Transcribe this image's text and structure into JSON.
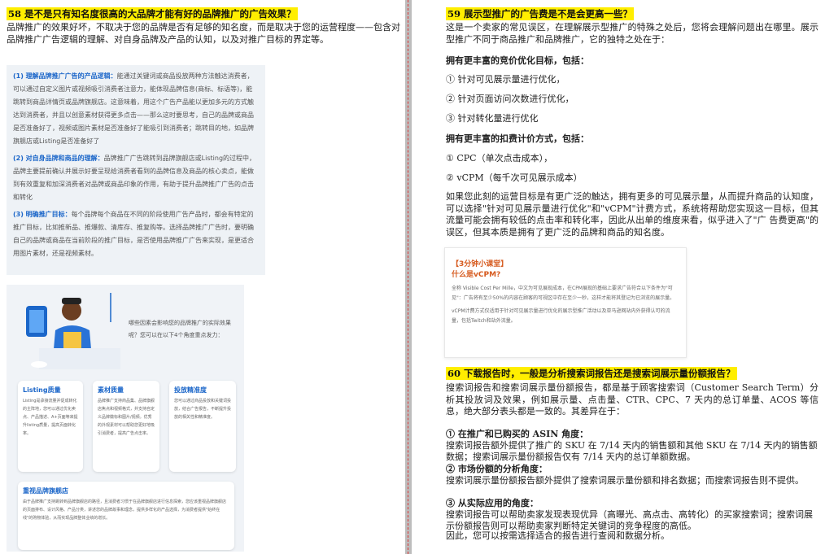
{
  "left": {
    "q58_title": "58 是不是只有知名度很高的大品牌才能有好的品牌推广的广告效果？",
    "q58_intro": "品牌推广的效果好坏，不取决于您的品牌是否有足够的知名度，而是取决于您的运营程度——包含对品牌推广广告逻辑的理解、对自身品牌及产品的认知，以及对推广目标的界定等。",
    "box": [
      {
        "head": "(1) 理解品牌推广广告的产品逻辑：",
        "body": "能通过关键词或商品投放两种方法触达消费者，可以通过自定义图片或视频吸引消费者注意力，能体现品牌信息(商标、标语等)，能跳转到商品详情页或品牌旗舰店。这意味着，用这个广告产品能以更加多元的方式触达到消费者，并且以创意素材获得更多点击——那么这时要思考，自己的品牌或商品是否准备好了，视频或图片素材是否准备好了能吸引到消费者；跳转目的地，如品牌旗舰店或Listing是否准备好了"
      },
      {
        "head": "(2) 对自身品牌和商品的理解：",
        "body": "品牌推广广告跳转到品牌旗舰店或Listing的过程中，品牌主要提前确认并展示好要呈现给消费者看到的品牌信息及商品的核心卖点，能做到有效重复和加深消费者对品牌或商品印象的作用，有助于提升品牌推广广告的点击和转化"
      },
      {
        "head": "(3) 明确推广目标：",
        "body": "每个品牌每个商品在不同的阶段使用广告产品时，都会有特定的推广目标，比如推新品、推爆款、清库存、推复购等。选择品牌推广广告时，要明确自己的品牌或商品在当前阶段的推广目标，是否使用品牌推广广告来实现，是更适合用图片素材，还是视频素材。"
      }
    ],
    "infographic": {
      "question": "哪些因素会影响您的品牌推广的实际效果呢？您可以在以下4个角度重点发力：",
      "cards": [
        {
          "title": "Listing质量",
          "body": "Listing是承接流量并促成转化的主阵地，您可以通过优化卖点、产品描述、A+页面等来提升listing质量，提高页面转化率。"
        },
        {
          "title": "素材质量",
          "body": "品牌推广支持商品集、品牌旗舰店焦点和视频格式，并支持自定义品牌徽标和图片/视频。优秀的外观素材可以帮助您更好地吸引消费者，提高广告点击率。"
        },
        {
          "title": "投放精准度",
          "body": "您可以通过商品投放和关键词投放，结合广告报告，不断提升投放的相关性和精准度。"
        },
        {
          "title": "重视品牌旗舰店",
          "body": "由于品牌推广支持跳转到品牌旗舰店的路径，且消费者习惯于在品牌旗舰店进行信息探索，您应该重视品牌旗舰店的页面排布、设计风格、产品分类，讲述您的品牌故事和理念，提供多样化的产品选择，为消费者提供\"始终在线\"的购物体验，从而实现品牌整体业绩的增长。"
        }
      ]
    }
  },
  "right": {
    "q59_title": "59 展示型推广的广告费是不是会更高一些？",
    "q59_intro": "这是一个卖家的常见误区，在理解展示型推广的特殊之处后，您将会理解问题出在哪里。展示型推广不同于商品推广和品牌推广，它的独特之处在于：",
    "h_targets": "拥有更丰富的竞价优化目标，包括：",
    "targets": [
      "① 针对可见展示量进行优化，",
      "② 针对页面访问次数进行优化，",
      "③ 针对转化量进行优化"
    ],
    "h_billing": "拥有更丰富的扣费计价方式，包括：",
    "billing": [
      "① CPC（单次点击成本），",
      "② vCPM（每千次可见展示成本）"
    ],
    "conclusion": "如果您此刻的运营目标是有更广泛的触达，拥有更多的可见展示量，从而提升商品的认知度，可以选择\"针对可见展示量进行优化\"和\"vCPM\"计费方式，系统将帮助您实现这一目标，但其流量可能会拥有较低的点击率和转化率，因此从出单的维度来看，似乎进入了\"广 告费更高\"的误区，但其本质是拥有了更广泛的品牌和商品的知名度。",
    "note": {
      "tag": "【3分钟小课堂】",
      "title": "什么是vCPM?",
      "p1": "全称 Visible Cost Per Mille，中文为可见展现成本，在CPM展现的基础上要求广告符合以下条件为\"可见\"：广告将有至少50%的内容在顾客的可视区中存在至少一秒，这样才能将其登记为已浏览的展示量。",
      "p2": "vCPM计费方式仅适用于针对可见展示量进行优化的展示型推广活动以及亚马逊网站内外获得认可的流量，包括Twitch和站外流量。"
    },
    "q60_title": "60 下载报告时，一般是分析搜索词报告还是搜索词展示量份额报告？",
    "q60_intro": "搜索词报告和搜索词展示量份额报告，都是基于顾客搜索词（Customer Search Term）分析其投放词及效果，例如展示量、点击量、CTR、CPC、7 天内的总订单量、ACOS 等信息，绝大部分表头都是一致的。其差异在于：",
    "diffs": [
      {
        "head": "① 在推广和已购买的 ASIN 角度：",
        "body": "搜索词报告额外提供了推广的 SKU 在 7/14 天内的销售额和其他 SKU 在 7/14 天内的销售额数据；搜索词展示量份额报告仅有 7/14 天内的总订单额数据。"
      },
      {
        "head": "② 市场份额的分析角度：",
        "body": "搜索词展示量份额报告额外提供了搜索词展示量份额和排名数据；而搜索词报告则不提供。"
      },
      {
        "head": "③ 从实际应用的角度：",
        "body": "搜索词报告可以帮助卖家发现表现优异（高曝光、高点击、高转化）的买家搜索词；搜索词展示份额报告则可以帮助卖家判断特定关键词的竞争程度的高低。"
      }
    ],
    "closing": "因此，您可以按需选择适合的报告进行查阅和数据分析。"
  }
}
